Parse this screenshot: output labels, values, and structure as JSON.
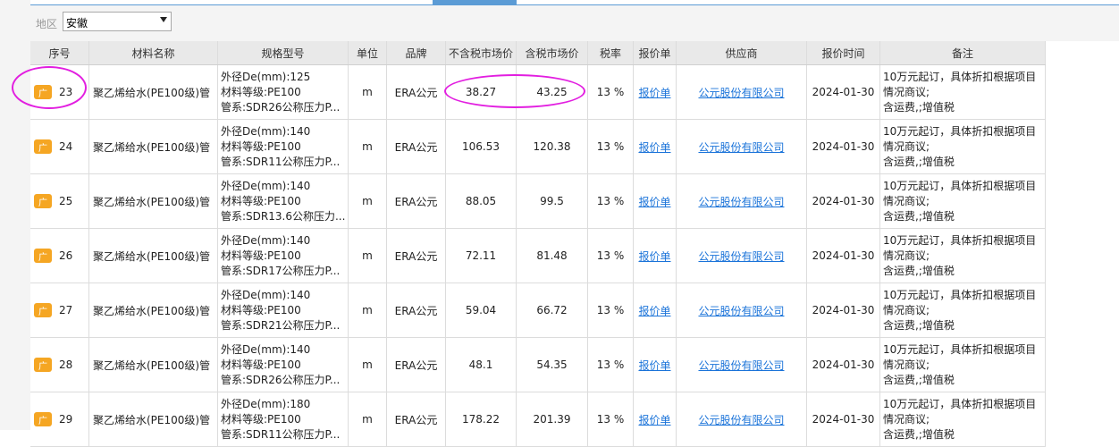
{
  "filter": {
    "label": "地区",
    "selected": "安徽"
  },
  "columns": [
    "序号",
    "材料名称",
    "规格型号",
    "单位",
    "品牌",
    "不含税市场价",
    "含税市场价",
    "税率",
    "报价单",
    "供应商",
    "报价时间",
    "备注"
  ],
  "rows": [
    {
      "badge": "广",
      "seq": "23",
      "name": "聚乙烯给水(PE100级)管",
      "spec1": "外径De(mm):125",
      "spec2": "材料等级:PE100",
      "spec3": "管系:SDR26公称压力P...",
      "unit": "m",
      "brand": "ERA公元",
      "price_ex": "38.27",
      "price_in": "43.25",
      "tax": "13 %",
      "quote": "报价单",
      "supplier": "公元股份有限公司",
      "date": "2024-01-30",
      "note1": "10万元起订，具体折扣根据项目",
      "note2": "情况商议;",
      "note3": "含运费,;增值税"
    },
    {
      "badge": "广",
      "seq": "24",
      "name": "聚乙烯给水(PE100级)管",
      "spec1": "外径De(mm):140",
      "spec2": "材料等级:PE100",
      "spec3": "管系:SDR11公称压力P...",
      "unit": "m",
      "brand": "ERA公元",
      "price_ex": "106.53",
      "price_in": "120.38",
      "tax": "13 %",
      "quote": "报价单",
      "supplier": "公元股份有限公司",
      "date": "2024-01-30",
      "note1": "10万元起订，具体折扣根据项目",
      "note2": "情况商议;",
      "note3": "含运费,;增值税"
    },
    {
      "badge": "广",
      "seq": "25",
      "name": "聚乙烯给水(PE100级)管",
      "spec1": "外径De(mm):140",
      "spec2": "材料等级:PE100",
      "spec3": "管系:SDR13.6公称压力...",
      "unit": "m",
      "brand": "ERA公元",
      "price_ex": "88.05",
      "price_in": "99.5",
      "tax": "13 %",
      "quote": "报价单",
      "supplier": "公元股份有限公司",
      "date": "2024-01-30",
      "note1": "10万元起订，具体折扣根据项目",
      "note2": "情况商议;",
      "note3": "含运费,;增值税"
    },
    {
      "badge": "广",
      "seq": "26",
      "name": "聚乙烯给水(PE100级)管",
      "spec1": "外径De(mm):140",
      "spec2": "材料等级:PE100",
      "spec3": "管系:SDR17公称压力P...",
      "unit": "m",
      "brand": "ERA公元",
      "price_ex": "72.11",
      "price_in": "81.48",
      "tax": "13 %",
      "quote": "报价单",
      "supplier": "公元股份有限公司",
      "date": "2024-01-30",
      "note1": "10万元起订，具体折扣根据项目",
      "note2": "情况商议;",
      "note3": "含运费,;增值税"
    },
    {
      "badge": "广",
      "seq": "27",
      "name": "聚乙烯给水(PE100级)管",
      "spec1": "外径De(mm):140",
      "spec2": "材料等级:PE100",
      "spec3": "管系:SDR21公称压力P...",
      "unit": "m",
      "brand": "ERA公元",
      "price_ex": "59.04",
      "price_in": "66.72",
      "tax": "13 %",
      "quote": "报价单",
      "supplier": "公元股份有限公司",
      "date": "2024-01-30",
      "note1": "10万元起订，具体折扣根据项目",
      "note2": "情况商议;",
      "note3": "含运费,;增值税"
    },
    {
      "badge": "广",
      "seq": "28",
      "name": "聚乙烯给水(PE100级)管",
      "spec1": "外径De(mm):140",
      "spec2": "材料等级:PE100",
      "spec3": "管系:SDR26公称压力P...",
      "unit": "m",
      "brand": "ERA公元",
      "price_ex": "48.1",
      "price_in": "54.35",
      "tax": "13 %",
      "quote": "报价单",
      "supplier": "公元股份有限公司",
      "date": "2024-01-30",
      "note1": "10万元起订，具体折扣根据项目",
      "note2": "情况商议;",
      "note3": "含运费,;增值税"
    },
    {
      "badge": "广",
      "seq": "29",
      "name": "聚乙烯给水(PE100级)管",
      "spec1": "外径De(mm):180",
      "spec2": "材料等级:PE100",
      "spec3": "管系:SDR11公称压力P...",
      "unit": "m",
      "brand": "ERA公元",
      "price_ex": "178.22",
      "price_in": "201.39",
      "tax": "13 %",
      "quote": "报价单",
      "supplier": "公元股份有限公司",
      "date": "2024-01-30",
      "note1": "10万元起订，具体折扣根据项目",
      "note2": "情况商议;",
      "note3": "含运费,;增值税"
    }
  ],
  "colors": {
    "accent": "#5b9bd5",
    "link": "#1a73d9",
    "badge": "#f5a623",
    "highlight": "#e21ee0"
  }
}
